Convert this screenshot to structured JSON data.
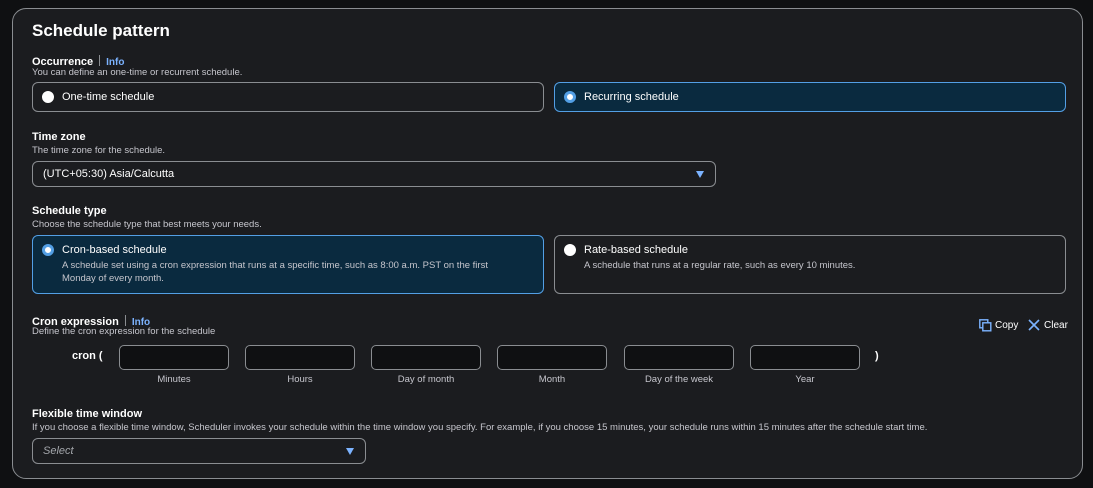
{
  "panel": {
    "title": "Schedule pattern"
  },
  "occurrence": {
    "label": "Occurrence",
    "info": "Info",
    "description": "You can define an one-time or recurrent schedule.",
    "options": [
      {
        "label": "One-time schedule",
        "selected": false
      },
      {
        "label": "Recurring schedule",
        "selected": true
      }
    ]
  },
  "timezone": {
    "label": "Time zone",
    "description": "The time zone for the schedule.",
    "value": "(UTC+05:30) Asia/Calcutta"
  },
  "schedule_type": {
    "label": "Schedule type",
    "description": "Choose the schedule type that best meets your needs.",
    "options": [
      {
        "label": "Cron-based schedule",
        "description": "A schedule set using a cron expression that runs at a specific time, such as 8:00 a.m. PST on the first Monday of every month.",
        "selected": true
      },
      {
        "label": "Rate-based schedule",
        "description": "A schedule that runs at a regular rate, such as every 10 minutes.",
        "selected": false
      }
    ]
  },
  "cron": {
    "label": "Cron expression",
    "info": "Info",
    "description": "Define the cron expression for the schedule",
    "copy": "Copy",
    "clear": "Clear",
    "open": "cron (",
    "close": ")",
    "fields": [
      {
        "caption": "Minutes",
        "value": ""
      },
      {
        "caption": "Hours",
        "value": ""
      },
      {
        "caption": "Day of month",
        "value": ""
      },
      {
        "caption": "Month",
        "value": ""
      },
      {
        "caption": "Day of the week",
        "value": ""
      },
      {
        "caption": "Year",
        "value": ""
      }
    ]
  },
  "flexible_window": {
    "label": "Flexible time window",
    "description": "If you choose a flexible time window, Scheduler invokes your schedule within the time window you specify. For example, if you choose 15 minutes, your schedule runs within 15 minutes after the schedule start time.",
    "placeholder": "Select"
  },
  "colors": {
    "accent": "#539fe5",
    "link": "#7cb3ff",
    "selected_bg": "#0a2a3f"
  },
  "icons": {
    "copy": "copy-icon",
    "clear": "close-icon",
    "dropdown": "caret-down-icon"
  }
}
